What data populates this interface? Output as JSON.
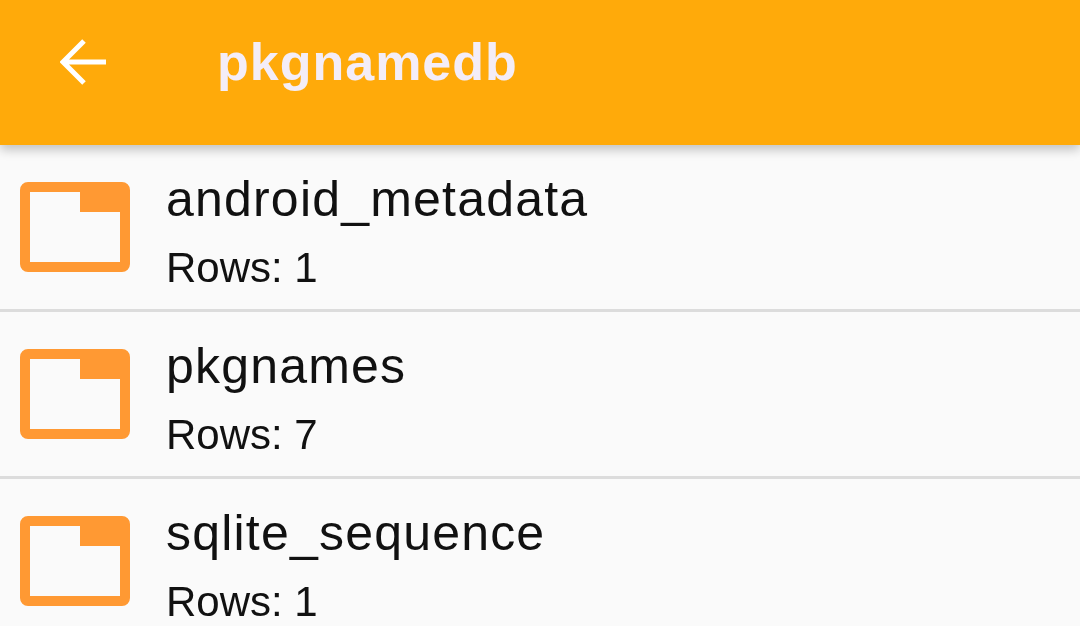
{
  "app_bar": {
    "title": "pkgnamedb"
  },
  "tables": [
    {
      "name": "android_metadata",
      "row_count": "Rows: 1"
    },
    {
      "name": "pkgnames",
      "row_count": "Rows: 7"
    },
    {
      "name": "sqlite_sequence",
      "row_count": "Rows: 1"
    }
  ]
}
